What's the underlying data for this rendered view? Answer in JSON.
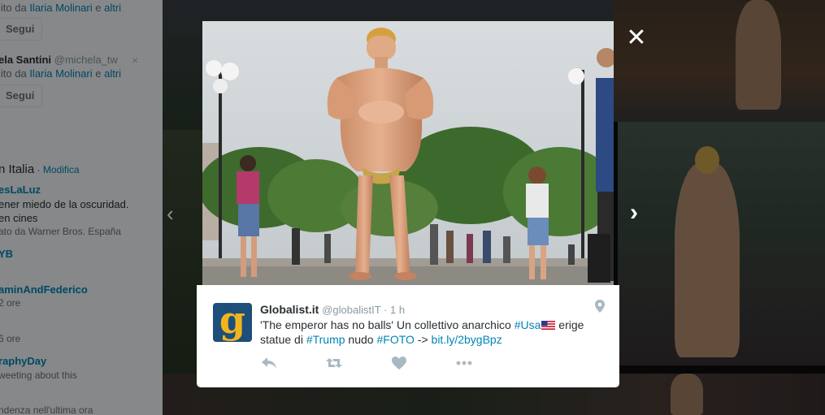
{
  "sidebar": {
    "top_context": {
      "prefix": "lito da ",
      "user": "Ilaria Molinari",
      "mid": " e ",
      "others": "altri"
    },
    "follow_1": "Segui",
    "suggestion": {
      "name": "ela Santini",
      "handle": "@michela_tw",
      "prefix": "lito da ",
      "user": "Ilaria Molinari",
      "mid": " e ",
      "others": "altri"
    },
    "follow_2": "Segui",
    "close_icon": "×",
    "trends_heading": "n Italia",
    "trends_sep": " · ",
    "trends_edit": "Modifica",
    "trends": [
      {
        "tag": "esLaLuz",
        "lines": [
          "ener miedo de la oscuridad.",
          "en cines"
        ],
        "promoted": "ato da Warner Bros. España"
      },
      {
        "tag": "YB",
        "lines": [],
        "promoted": ""
      },
      {
        "tag": "aminAndFederico",
        "lines": [],
        "sub": "2 ore"
      },
      {
        "tag": "",
        "lines": [],
        "sub": "6 ore"
      },
      {
        "tag": "raphyDay",
        "lines": [],
        "sub": "weeting about this"
      },
      {
        "tag": "",
        "lines": [],
        "sub": "ndenza nell'ultima ora"
      }
    ]
  },
  "overlay": {
    "close_glyph": "✕",
    "prev_glyph": "‹",
    "next_glyph": "›"
  },
  "tweet": {
    "avatar_letter": "g",
    "name": "Globalist.it",
    "handle": "@globalistIT",
    "separator": " · ",
    "time": "1 h",
    "text": {
      "part1": "'The emperor has no balls' Un collettivo anarchico ",
      "hashtag1": "#Usa",
      "part2": " erige statue di ",
      "hashtag2": "#Trump",
      "part3": " nudo ",
      "hashtag3": "#FOTO",
      "part4": " -> ",
      "link": "bit.ly/2bygBpz"
    },
    "icons": [
      "reply-icon",
      "retweet-icon",
      "like-icon",
      "more-icon",
      "location-pin-icon"
    ]
  },
  "colors": {
    "link": "#0084b4",
    "text": "#292f33",
    "muted": "#8899a6",
    "icon": "#aab8c2",
    "avatar_bg": "#1d4f7a",
    "avatar_fg": "#f0b51e"
  }
}
